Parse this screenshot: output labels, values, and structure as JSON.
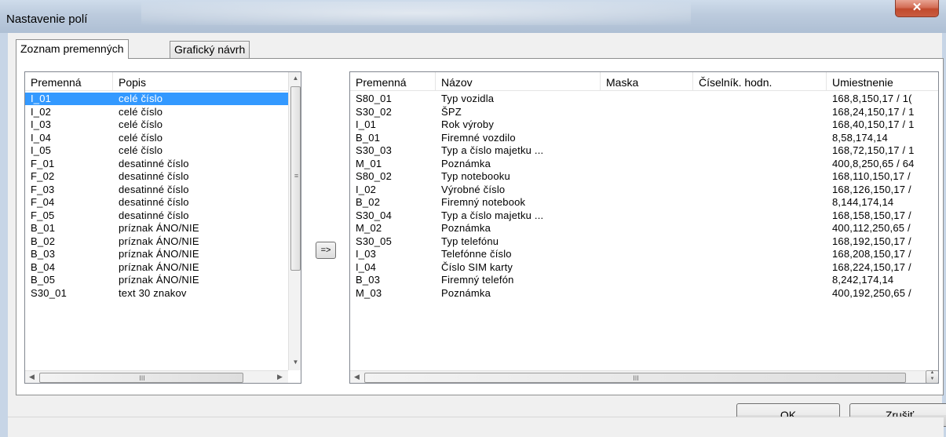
{
  "window": {
    "title": "Nastavenie polí",
    "close_symbol": "✕"
  },
  "tabs": [
    {
      "label": "Zoznam premenných",
      "active": true
    },
    {
      "label": "Grafický návrh",
      "active": false
    }
  ],
  "left_list": {
    "columns": [
      "Premenná",
      "Popis"
    ],
    "selected_index": 0,
    "rows": [
      [
        "I_01",
        "celé číslo"
      ],
      [
        "I_02",
        "celé číslo"
      ],
      [
        "I_03",
        "celé číslo"
      ],
      [
        "I_04",
        "celé číslo"
      ],
      [
        "I_05",
        "celé číslo"
      ],
      [
        "F_01",
        "desatinné číslo"
      ],
      [
        "F_02",
        "desatinné číslo"
      ],
      [
        "F_03",
        "desatinné číslo"
      ],
      [
        "F_04",
        "desatinné číslo"
      ],
      [
        "F_05",
        "desatinné číslo"
      ],
      [
        "B_01",
        "príznak ÁNO/NIE"
      ],
      [
        "B_02",
        "príznak ÁNO/NIE"
      ],
      [
        "B_03",
        "príznak ÁNO/NIE"
      ],
      [
        "B_04",
        "príznak ÁNO/NIE"
      ],
      [
        "B_05",
        "príznak ÁNO/NIE"
      ],
      [
        "S30_01",
        "text 30 znakov"
      ]
    ]
  },
  "move_button": {
    "label": "=>"
  },
  "right_list": {
    "columns": [
      "Premenná",
      "Názov",
      "Maska",
      "Číselník. hodn.",
      "Umiestnenie"
    ],
    "rows": [
      [
        "S80_01",
        "Typ vozidla",
        "",
        "",
        "168,8,150,17 / 1("
      ],
      [
        "S30_02",
        "ŠPZ",
        "",
        "",
        "168,24,150,17 / 1"
      ],
      [
        "I_01",
        "Rok výroby",
        "",
        "",
        "168,40,150,17 / 1"
      ],
      [
        "B_01",
        "Firemné vozdilo",
        "",
        "",
        "8,58,174,14"
      ],
      [
        "S30_03",
        "Typ a číslo majetku ...",
        "",
        "",
        "168,72,150,17 / 1"
      ],
      [
        "M_01",
        "Poznámka",
        "",
        "",
        "400,8,250,65 / 64"
      ],
      [
        "S80_02",
        "Typ notebooku",
        "",
        "",
        "168,110,150,17 /"
      ],
      [
        "I_02",
        "Výrobné číslo",
        "",
        "",
        "168,126,150,17 /"
      ],
      [
        "B_02",
        "Firemný notebook",
        "",
        "",
        "8,144,174,14"
      ],
      [
        "S30_04",
        "Typ a číslo majetku ...",
        "",
        "",
        "168,158,150,17 /"
      ],
      [
        "M_02",
        "Poznámka",
        "",
        "",
        "400,112,250,65 /"
      ],
      [
        "S30_05",
        "Typ telefónu",
        "",
        "",
        "168,192,150,17 /"
      ],
      [
        "I_03",
        "Telefónne číslo",
        "",
        "",
        "168,208,150,17 /"
      ],
      [
        "I_04",
        "Číslo SIM karty",
        "",
        "",
        "168,224,150,17 /"
      ],
      [
        "B_03",
        "Firemný telefón",
        "",
        "",
        "8,242,174,14"
      ],
      [
        "M_03",
        "Poznámka",
        "",
        "",
        "400,192,250,65 /"
      ]
    ]
  },
  "buttons": {
    "ok": "OK",
    "cancel": "Zrušiť"
  },
  "scroll_symbols": {
    "up": "▲",
    "down": "▼",
    "left": "◀",
    "right": "▶",
    "grip_v": "≡",
    "grip_h": "III"
  }
}
